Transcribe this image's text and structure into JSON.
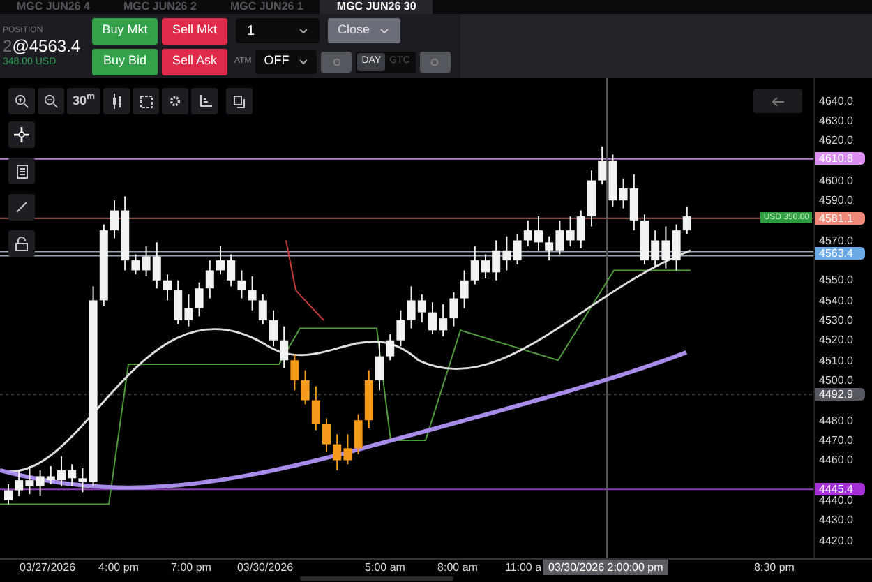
{
  "instrument_tabs": [
    {
      "label": "MGC JUN26 4",
      "selected": false
    },
    {
      "label": "MGC JUN26 2",
      "selected": false
    },
    {
      "label": "MGC JUN26 1",
      "selected": false
    },
    {
      "label": "MGC JUN26 30",
      "selected": true
    }
  ],
  "position": {
    "label": "POSITION",
    "quantity": "2",
    "price": "@4563.4",
    "pnl": "348.00 USD"
  },
  "order_buttons": [
    {
      "label": "Buy Mkt",
      "kind": "buy"
    },
    {
      "label": "Sell Mkt",
      "kind": "sell"
    },
    {
      "label": "Buy Bid",
      "kind": "buy"
    },
    {
      "label": "Sell Ask",
      "kind": "sell"
    }
  ],
  "quantity": {
    "value": "1"
  },
  "close_button": {
    "label": "Close"
  },
  "atm": {
    "label": "ATM",
    "value": "OFF"
  },
  "time_in_force": [
    {
      "label": "DAY",
      "selected": true
    },
    {
      "label": "GTC",
      "selected": false
    }
  ],
  "chart": {
    "interval": "30$^{m}$",
    "price_ticks": [
      "4640.0",
      "4630.0",
      "4620.0",
      "4600.0",
      "4590.0",
      "4570.0",
      "4550.0",
      "4540.0",
      "4530.0",
      "4520.0",
      "4510.0",
      "4500.0",
      "4480.0",
      "4470.0",
      "4460.0",
      "4440.0",
      "4430.0",
      "4420.0"
    ],
    "price_tags": [
      {
        "label": "4610.8",
        "color": "#d98ef0"
      },
      {
        "label": "4581.1",
        "color": "#f08a78"
      },
      {
        "label": "4563.4",
        "color": "#6aa8e6"
      },
      {
        "label": "4492.9",
        "color": "#555861"
      },
      {
        "label": "4445.4",
        "color": "#a42fd6"
      }
    ],
    "pnl_tag": "USD 350.00",
    "time_labels": [
      "03/27/2026",
      "4:00 pm",
      "7:00 pm",
      "03/30/2026",
      "5:00 am",
      "8:00 am",
      "11:00 a",
      "8:30 pm"
    ],
    "crosshair_label": "03/30/2026 2:00:00 pm"
  }
}
